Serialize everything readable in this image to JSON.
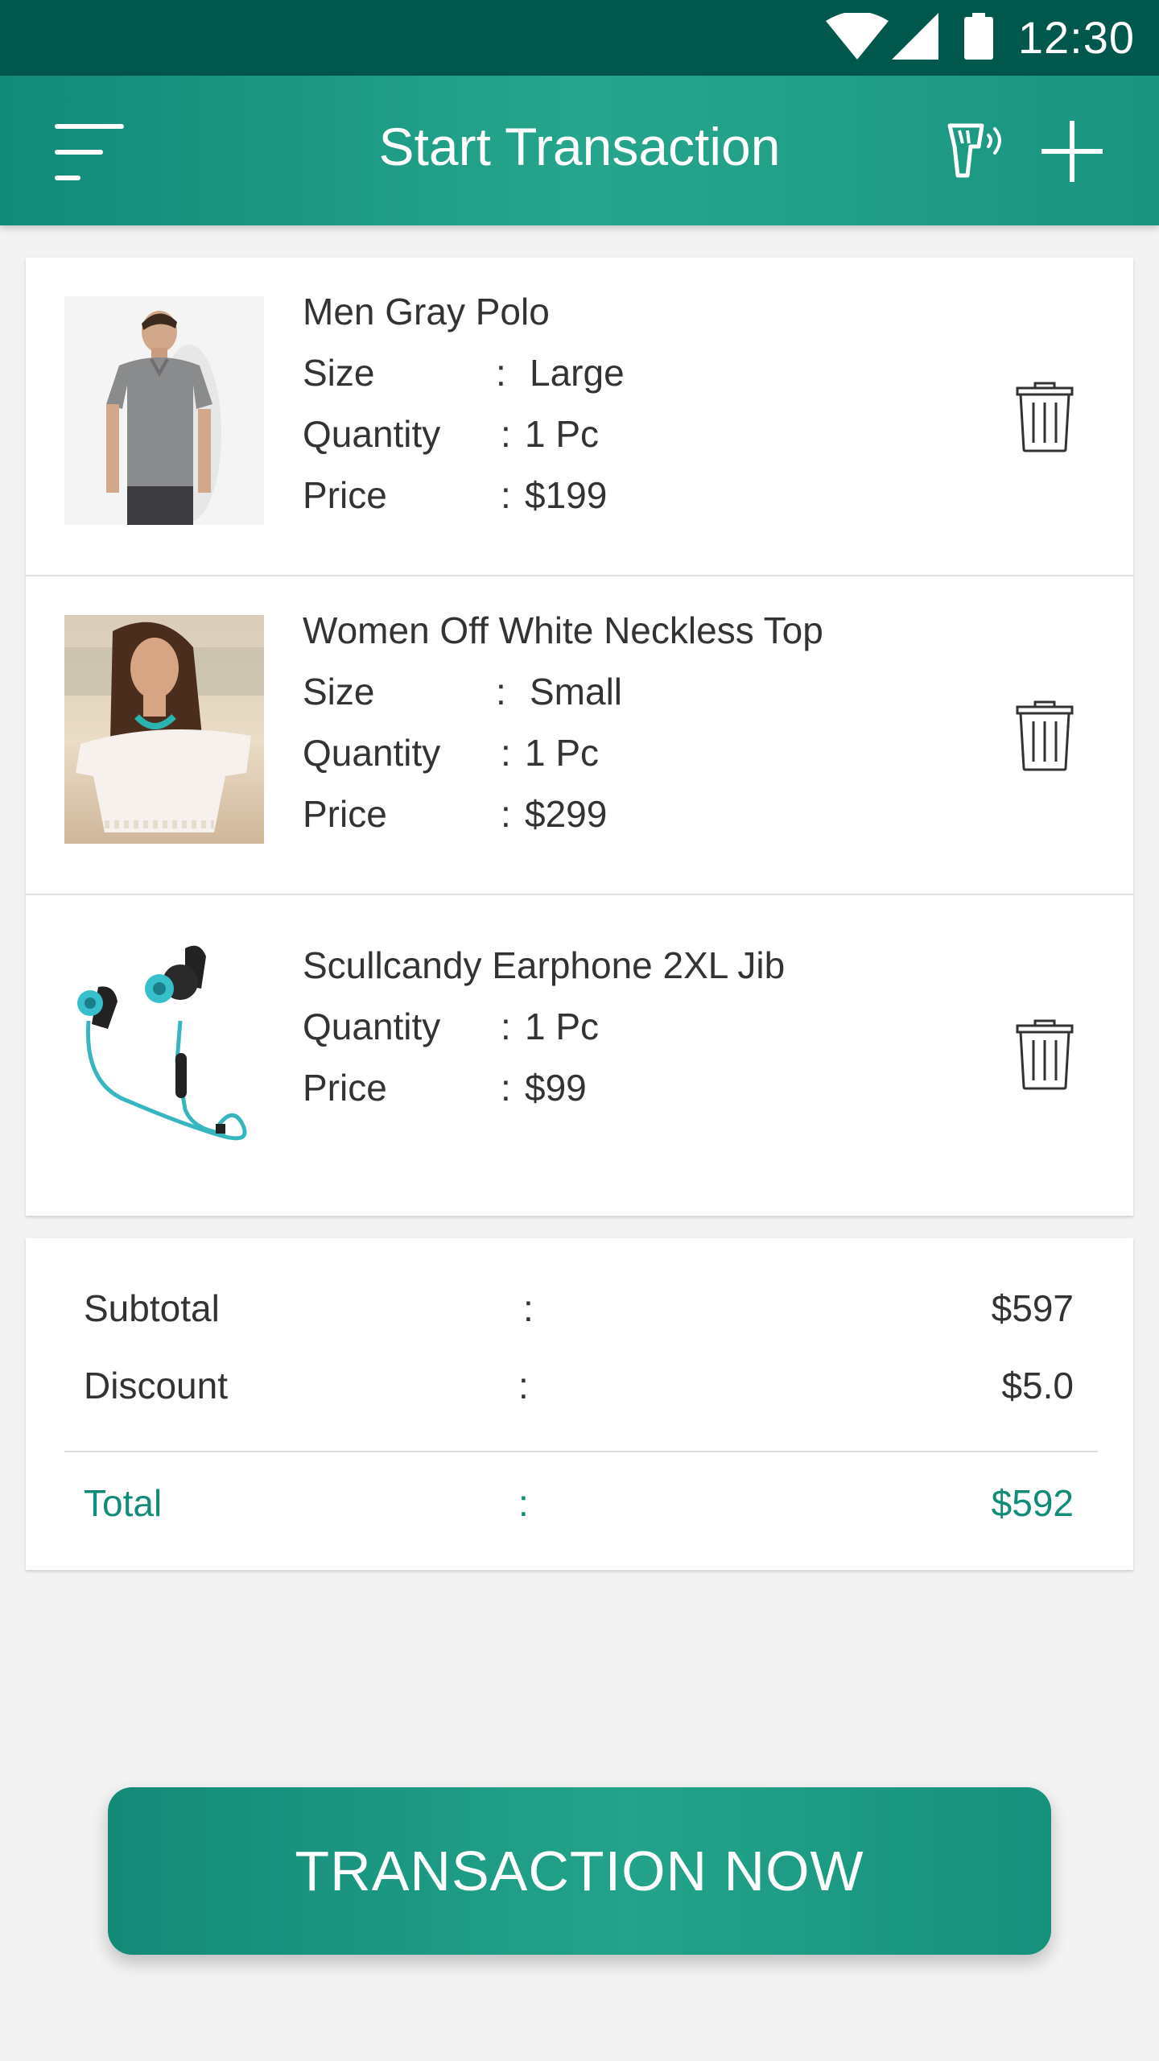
{
  "status_bar": {
    "time": "12:30"
  },
  "app_bar": {
    "title": "Start Transaction",
    "menu_icon": "menu-icon",
    "scanner_icon": "barcode-scanner-icon",
    "add_icon": "add-icon"
  },
  "items": [
    {
      "name": "Men Gray Polo",
      "rows": [
        {
          "label": "Size",
          "colon": ":",
          "value": "Large"
        },
        {
          "label": "Quantity",
          "colon": ":",
          "value": "1 Pc"
        },
        {
          "label": "Price",
          "colon": ":",
          "value": "$199"
        }
      ],
      "delete_icon": "trash-icon"
    },
    {
      "name": "Women Off White Neckless Top",
      "rows": [
        {
          "label": "Size",
          "colon": ":",
          "value": "Small"
        },
        {
          "label": "Quantity",
          "colon": ":",
          "value": "1 Pc"
        },
        {
          "label": "Price",
          "colon": ":",
          "value": "$299"
        }
      ],
      "delete_icon": "trash-icon"
    },
    {
      "name": "Scullcandy Earphone 2XL Jib",
      "rows": [
        {
          "label": "Quantity",
          "colon": ":",
          "value": "1 Pc"
        },
        {
          "label": "Price",
          "colon": ":",
          "value": "$99"
        }
      ],
      "delete_icon": "trash-icon"
    }
  ],
  "summary": {
    "subtotal": {
      "label": "Subtotal",
      "colon": ":",
      "value": "$597"
    },
    "discount": {
      "label": "Discount",
      "colon": ":",
      "value": "$5.0"
    },
    "total": {
      "label": "Total",
      "colon": ":",
      "value": "$592"
    }
  },
  "cta": {
    "label": "TRANSACTION NOW"
  },
  "colors": {
    "primary": "#1a9580",
    "status_bar": "#00574c",
    "total_text": "#128c78"
  }
}
